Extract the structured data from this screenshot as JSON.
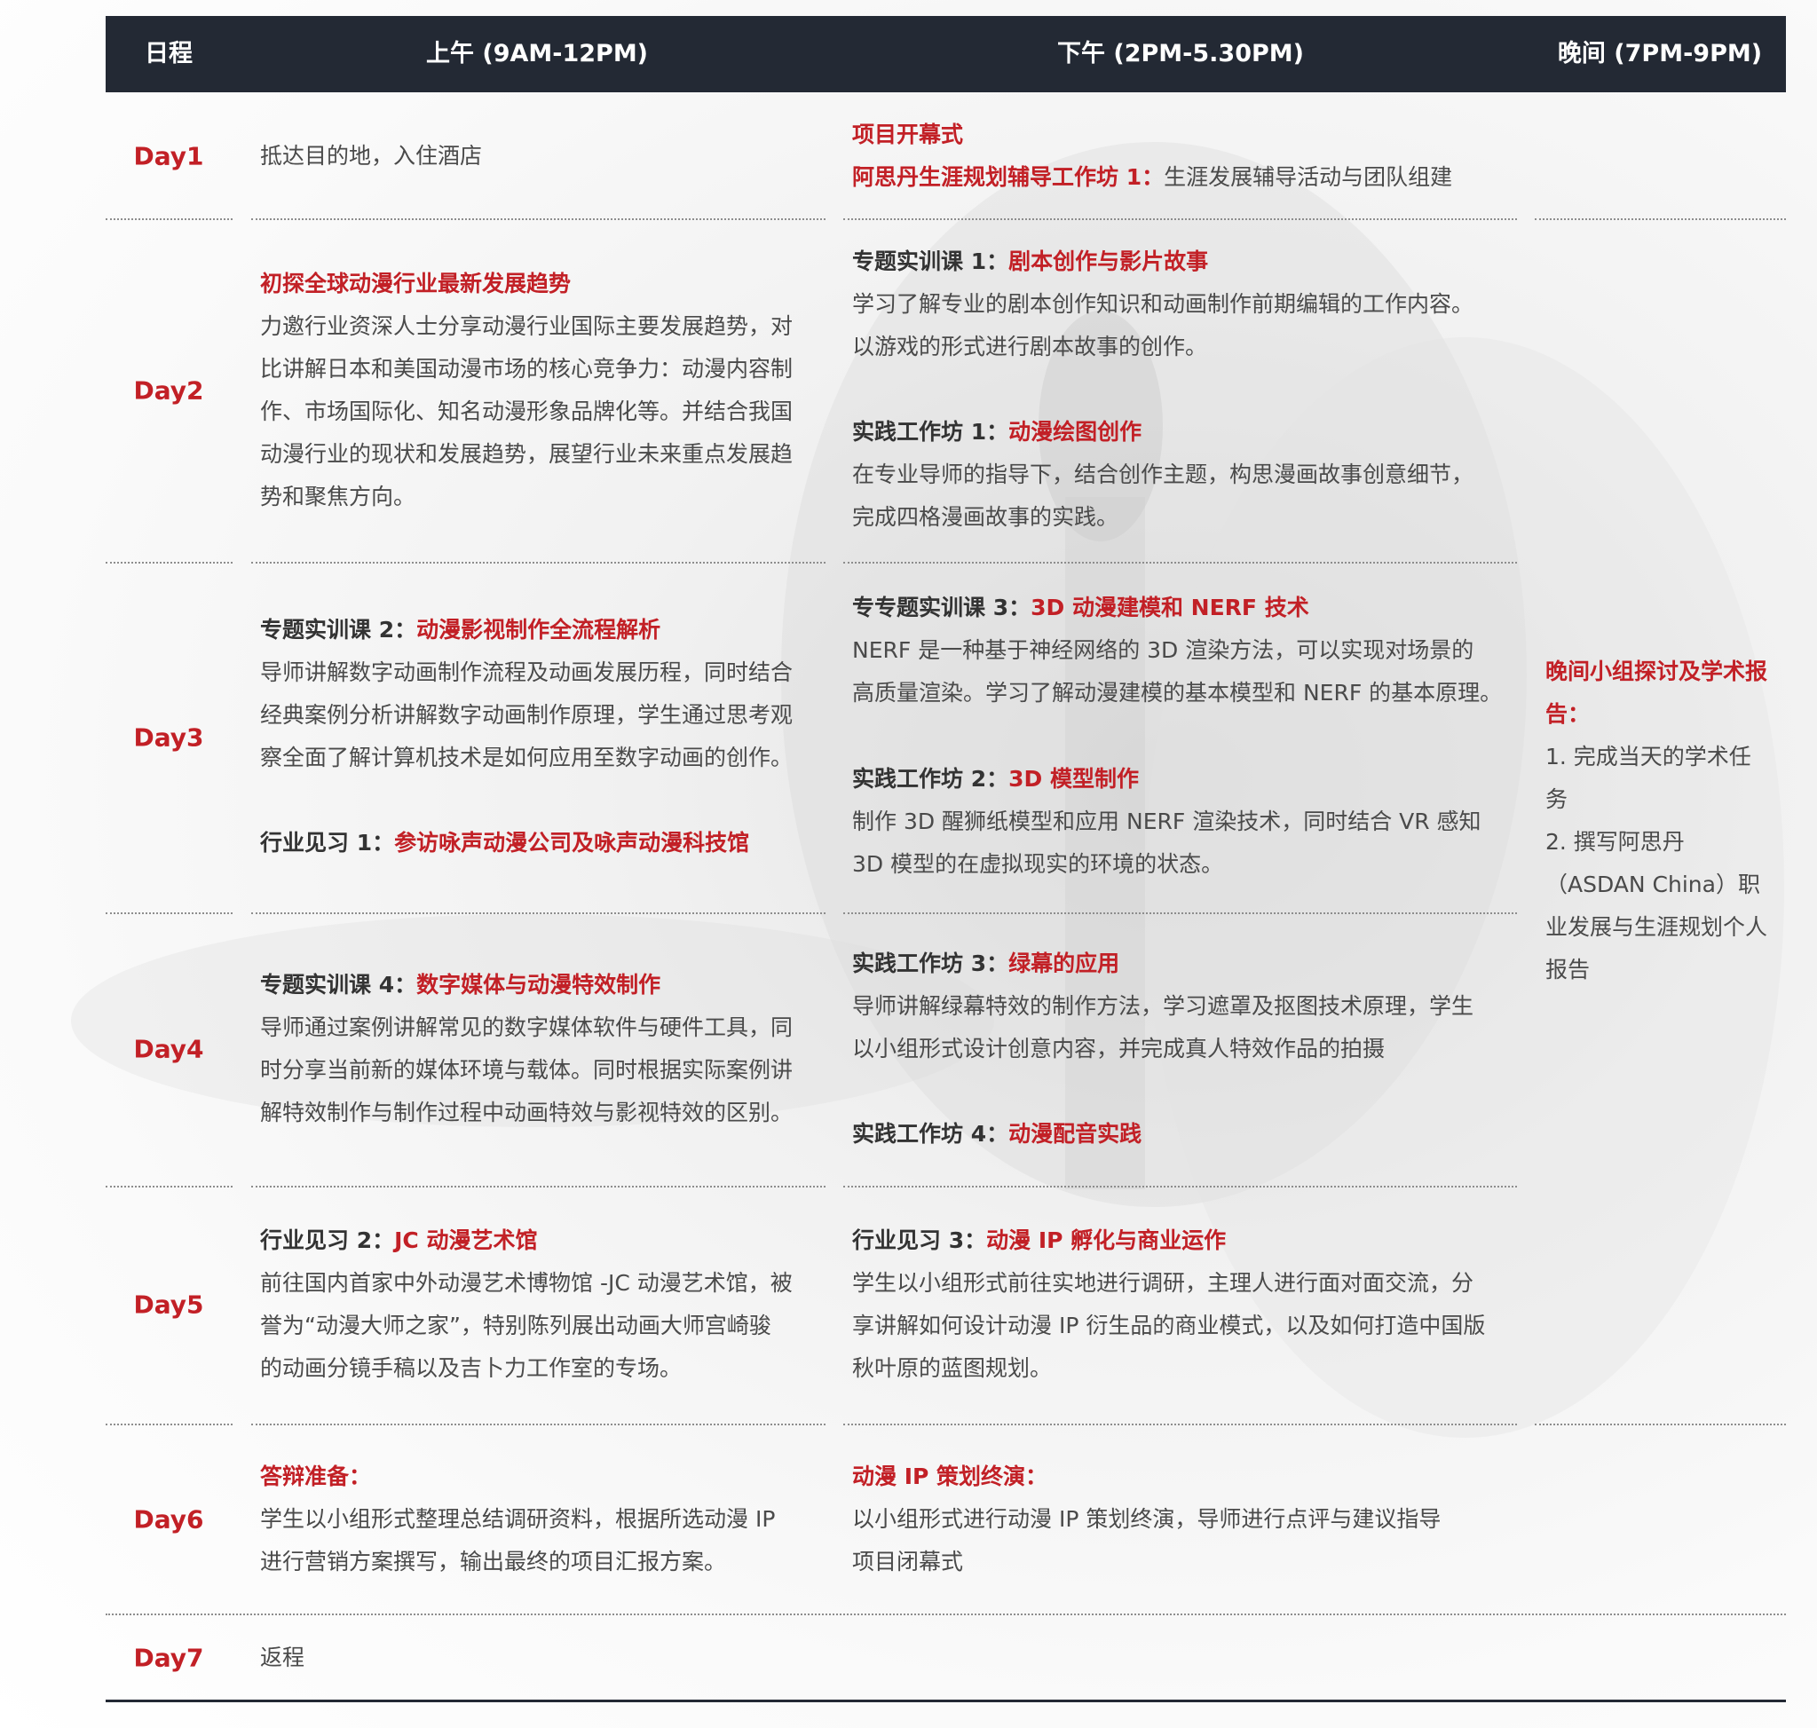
{
  "header": {
    "col_day": "日程",
    "col_morning": "上午 (9AM-12PM)",
    "col_afternoon": "下午 (2PM-5.30PM)",
    "col_evening": "晚间 (7PM-9PM)"
  },
  "days": {
    "d1": {
      "label": "Day1",
      "morning": "抵达目的地，入住酒店",
      "pm1_title": "项目开幕式",
      "pm2_title": "阿思丹生涯规划辅导工作坊 1：",
      "pm2_text": "生涯发展辅导活动与团队组建"
    },
    "d2": {
      "label": "Day2",
      "am_title": "初探全球动漫行业最新发展趋势",
      "am_lines": [
        "力邀行业资深人士分享动漫行业国际主要发展趋势，对",
        "比讲解日本和美国动漫市场的核心竞争力：动漫内容制",
        "作、市场国际化、知名动漫形象品牌化等。并结合我国",
        "动漫行业的现状和发展趋势，展望行业未来重点发展趋",
        "势和聚焦方向。"
      ],
      "pm1_prefix": "专题实训课 1：",
      "pm1_title": "剧本创作与影片故事",
      "pm1_lines": [
        "学习了解专业的剧本创作知识和动画制作前期编辑的工作内容。",
        "以游戏的形式进行剧本故事的创作。"
      ],
      "pm2_prefix": "实践工作坊 1：",
      "pm2_title": "动漫绘图创作",
      "pm2_lines": [
        "在专业导师的指导下，结合创作主题，构思漫画故事创意细节，",
        "完成四格漫画故事的实践。"
      ]
    },
    "d3": {
      "label": "Day3",
      "am1_prefix": "专题实训课 2：",
      "am1_title": "动漫影视制作全流程解析",
      "am1_lines": [
        "导师讲解数字动画制作流程及动画发展历程，同时结合",
        "经典案例分析讲解数字动画制作原理，学生通过思考观",
        "察全面了解计算机技术是如何应用至数字动画的创作。"
      ],
      "am2_prefix": "行业见习 1：",
      "am2_title": "参访咏声动漫公司及咏声动漫科技馆",
      "pm1_prefix": "专专题实训课 3：",
      "pm1_title": "3D 动漫建模和 NERF 技术",
      "pm1_lines": [
        "NERF 是一种基于神经网络的 3D 渲染方法，可以实现对场景的",
        "高质量渲染。学习了解动漫建模的基本模型和 NERF 的基本原理。"
      ],
      "pm2_prefix": "实践工作坊 2：",
      "pm2_title": "3D 模型制作",
      "pm2_lines": [
        "制作 3D 醒狮纸模型和应用 NERF 渲染技术，同时结合 VR 感知",
        "3D 模型的在虚拟现实的环境的状态。"
      ]
    },
    "d4": {
      "label": "Day4",
      "am_prefix": "专题实训课 4：",
      "am_title": "数字媒体与动漫特效制作",
      "am_lines": [
        "导师通过案例讲解常见的数字媒体软件与硬件工具，同",
        "时分享当前新的媒体环境与载体。同时根据实际案例讲",
        "解特效制作与制作过程中动画特效与影视特效的区别。"
      ],
      "pm1_prefix": "实践工作坊 3：",
      "pm1_title": "绿幕的应用",
      "pm1_lines": [
        "导师讲解绿幕特效的制作方法，学习遮罩及抠图技术原理，学生",
        "以小组形式设计创意内容，并完成真人特效作品的拍摄"
      ],
      "pm2_prefix": "实践工作坊 4：",
      "pm2_title": "动漫配音实践"
    },
    "d5": {
      "label": "Day5",
      "am_prefix": "行业见习 2：",
      "am_title": "JC 动漫艺术馆",
      "am_lines": [
        "前往国内首家中外动漫艺术博物馆 -JC 动漫艺术馆，被",
        "誉为“动漫大师之家”，特别陈列展出动画大师宫崎骏",
        "的动画分镜手稿以及吉卜力工作室的专场。"
      ],
      "pm_prefix": "行业见习 3：",
      "pm_title": "动漫 IP 孵化与商业运作",
      "pm_lines": [
        "学生以小组形式前往实地进行调研，主理人进行面对面交流，分",
        "享讲解如何设计动漫 IP 衍生品的商业模式，以及如何打造中国版",
        "秋叶原的蓝图规划。"
      ]
    },
    "d6": {
      "label": "Day6",
      "am_title": "答辩准备：",
      "am_lines": [
        "学生以小组形式整理总结调研资料，根据所选动漫 IP",
        "进行营销方案撰写，输出最终的项目汇报方案。"
      ],
      "pm_title": "动漫 IP 策划终演：",
      "pm_lines": [
        "以小组形式进行动漫 IP 策划终演，导师进行点评与建议指导",
        "项目闭幕式"
      ]
    },
    "d7": {
      "label": "Day7",
      "morning": "返程"
    }
  },
  "evening": {
    "title_lines": [
      "晚间小组探讨及学术报",
      "告："
    ],
    "body_lines": [
      "1. 完成当天的学术任",
      "务",
      "2. 撰写阿思丹",
      "（ASDAN China）职",
      "业发展与生涯规划个人",
      "报告"
    ]
  },
  "colors": {
    "header_bg": "#232934",
    "accent_red": "#c22026",
    "body_text": "#4a4a4a"
  }
}
